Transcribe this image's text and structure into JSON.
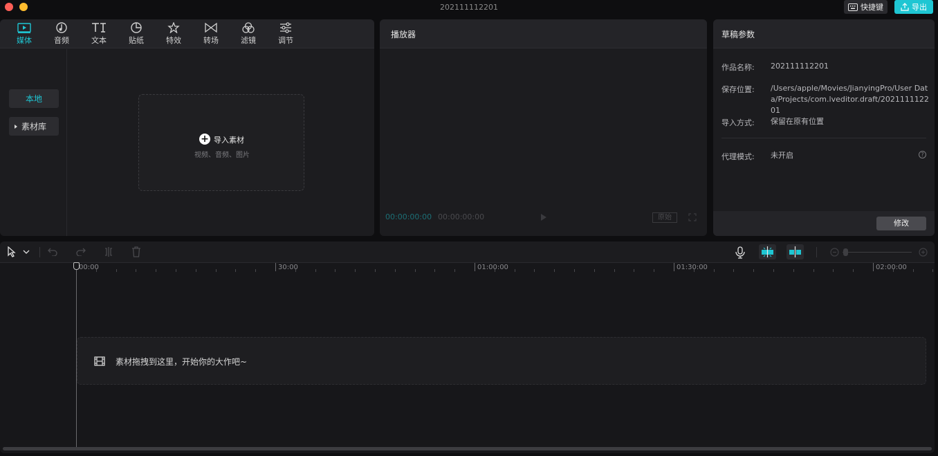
{
  "window": {
    "title": "202111112201"
  },
  "titlebar": {
    "shortcut_label": "快捷键",
    "export_label": "导出"
  },
  "media": {
    "tabs": [
      {
        "label": "媒体",
        "icon": "media-icon"
      },
      {
        "label": "音频",
        "icon": "audio-icon"
      },
      {
        "label": "文本",
        "icon": "text-icon"
      },
      {
        "label": "贴纸",
        "icon": "sticker-icon"
      },
      {
        "label": "特效",
        "icon": "effects-icon"
      },
      {
        "label": "转场",
        "icon": "transition-icon"
      },
      {
        "label": "滤镜",
        "icon": "filter-icon"
      },
      {
        "label": "调节",
        "icon": "adjust-icon"
      }
    ],
    "active_tab": "媒体",
    "sidebar": {
      "local": "本地",
      "library": "素材库"
    },
    "import": {
      "label": "导入素材",
      "sub": "视频、音频、图片"
    }
  },
  "player": {
    "title": "播放器",
    "current_time": "00:00:00:00",
    "total_time": "00:00:00:00",
    "ratio_label": "原始"
  },
  "draft": {
    "title": "草稿参数",
    "fields": [
      {
        "label": "作品名称:",
        "value": "202111112201"
      },
      {
        "label": "保存位置:",
        "value": "/Users/apple/Movies/JianyingPro/User Data/Projects/com.lveditor.draft/202111112201"
      },
      {
        "label": "导入方式:",
        "value": "保留在原有位置"
      },
      {
        "label": "代理模式:",
        "value": "未开启"
      }
    ],
    "modify_label": "修改"
  },
  "timeline": {
    "ruler_labels": [
      "00:00",
      "30:00",
      "01:00:00",
      "01:30:00",
      "02:00:00"
    ],
    "drop_hint": "素材拖拽到这里，开始你的大作吧~"
  },
  "colors": {
    "accent": "#1fc6d3",
    "panel": "#1c1c1f",
    "background": "#0e0e10"
  }
}
